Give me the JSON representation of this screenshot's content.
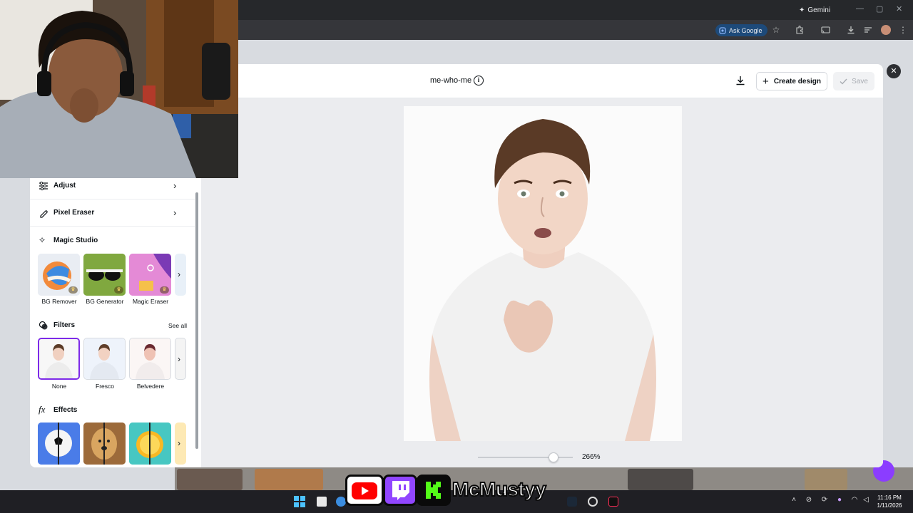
{
  "browser": {
    "gemini_label": "Gemini",
    "ask_google_label": "Ask Google"
  },
  "editor": {
    "file_name": "me-who-me",
    "create_design_label": "Create design",
    "save_label": "Save",
    "zoom_value": "266%",
    "zoom_level": 0.8
  },
  "panel": {
    "adjust_label": "Adjust",
    "pixel_eraser_label": "Pixel Eraser",
    "magic_studio": {
      "title": "Magic Studio",
      "tools": [
        {
          "label": "BG Remover"
        },
        {
          "label": "BG Generator"
        },
        {
          "label": "Magic Eraser"
        }
      ]
    },
    "filters": {
      "title": "Filters",
      "see_all": "See all",
      "items": [
        {
          "label": "None"
        },
        {
          "label": "Fresco"
        },
        {
          "label": "Belvedere"
        }
      ]
    },
    "effects": {
      "title": "Effects"
    }
  },
  "taskbar": {
    "time": "11:16 PM",
    "date": "1/11/2026"
  },
  "stream_overlay": {
    "channel": "McMustyy"
  },
  "colors": {
    "accent": "#7d2ae8",
    "save_disabled_text": "#a9adb3",
    "chrome_dark": "#26282b"
  }
}
